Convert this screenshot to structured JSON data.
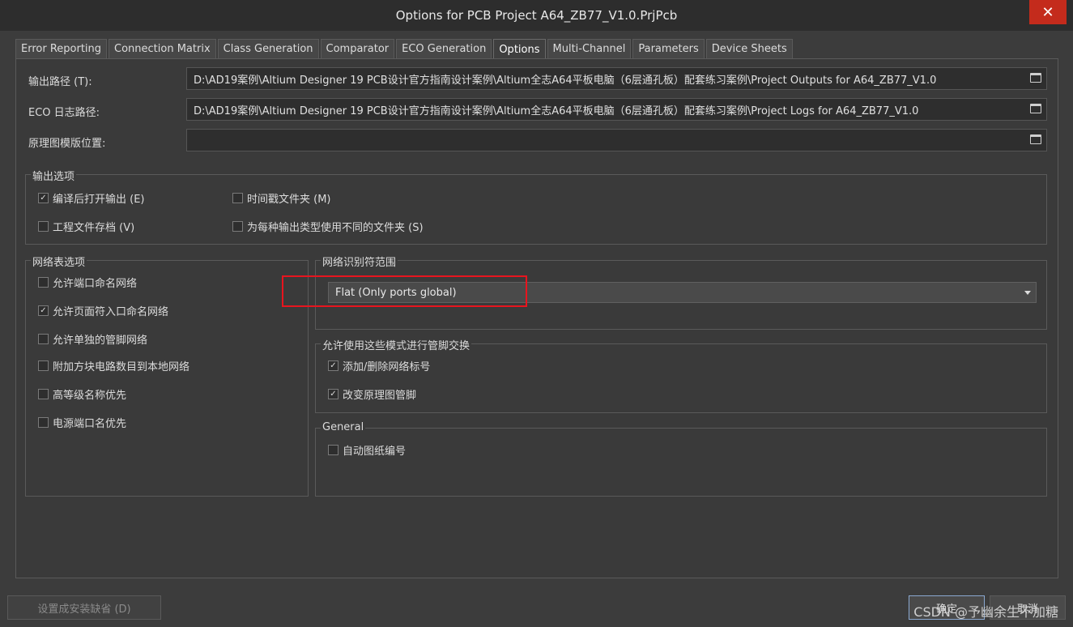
{
  "window": {
    "title": "Options for PCB Project A64_ZB77_V1.0.PrjPcb",
    "close_glyph": "✕"
  },
  "tabs": [
    {
      "label": "Error Reporting"
    },
    {
      "label": "Connection Matrix"
    },
    {
      "label": "Class Generation"
    },
    {
      "label": "Comparator"
    },
    {
      "label": "ECO Generation"
    },
    {
      "label": "Options"
    },
    {
      "label": "Multi-Channel"
    },
    {
      "label": "Parameters"
    },
    {
      "label": "Device Sheets"
    }
  ],
  "fields": {
    "output_path_label": "输出路径 (T):",
    "output_path_value": "D:\\AD19案例\\Altium Designer 19 PCB设计官方指南设计案例\\Altium全志A64平板电脑（6层通孔板）配套练习案例\\Project Outputs for A64_ZB77_V1.0",
    "eco_log_label": "ECO 日志路径:",
    "eco_log_value": "D:\\AD19案例\\Altium Designer 19 PCB设计官方指南设计案例\\Altium全志A64平板电脑（6层通孔板）配套练习案例\\Project Logs for A64_ZB77_V1.0",
    "template_label": "原理图模版位置:",
    "template_value": ""
  },
  "output_options": {
    "title": "输出选项",
    "items": [
      {
        "label": "编译后打开输出 (E)",
        "checked": true
      },
      {
        "label": "时间戳文件夹 (M)",
        "checked": false
      },
      {
        "label": "工程文件存档 (V)",
        "checked": false
      },
      {
        "label": "为每种输出类型使用不同的文件夹 (S)",
        "checked": false
      }
    ]
  },
  "netlist_options": {
    "title": "网络表选项",
    "items": [
      {
        "label": "允许端口命名网络",
        "checked": false
      },
      {
        "label": "允许页面符入口命名网络",
        "checked": true
      },
      {
        "label": "允许单独的管脚网络",
        "checked": false
      },
      {
        "label": "附加方块电路数目到本地网络",
        "checked": false
      },
      {
        "label": "高等级名称优先",
        "checked": false
      },
      {
        "label": "电源端口名优先",
        "checked": false
      }
    ]
  },
  "net_identifier": {
    "title": "网络识别符范围",
    "selected": "Flat (Only ports global)"
  },
  "pin_swap": {
    "title": "允许使用这些模式进行管脚交换",
    "items": [
      {
        "label": "添加/删除网络标号",
        "checked": true
      },
      {
        "label": "改变原理图管脚",
        "checked": true
      }
    ]
  },
  "general": {
    "title": "General",
    "items": [
      {
        "label": "自动图纸编号",
        "checked": false
      }
    ]
  },
  "buttons": {
    "set_default": "设置成安装缺省 (D)",
    "ok": "确定",
    "cancel": "取消"
  },
  "watermark": "CSDN @予幽余生不加糖",
  "check_glyph": "✓"
}
